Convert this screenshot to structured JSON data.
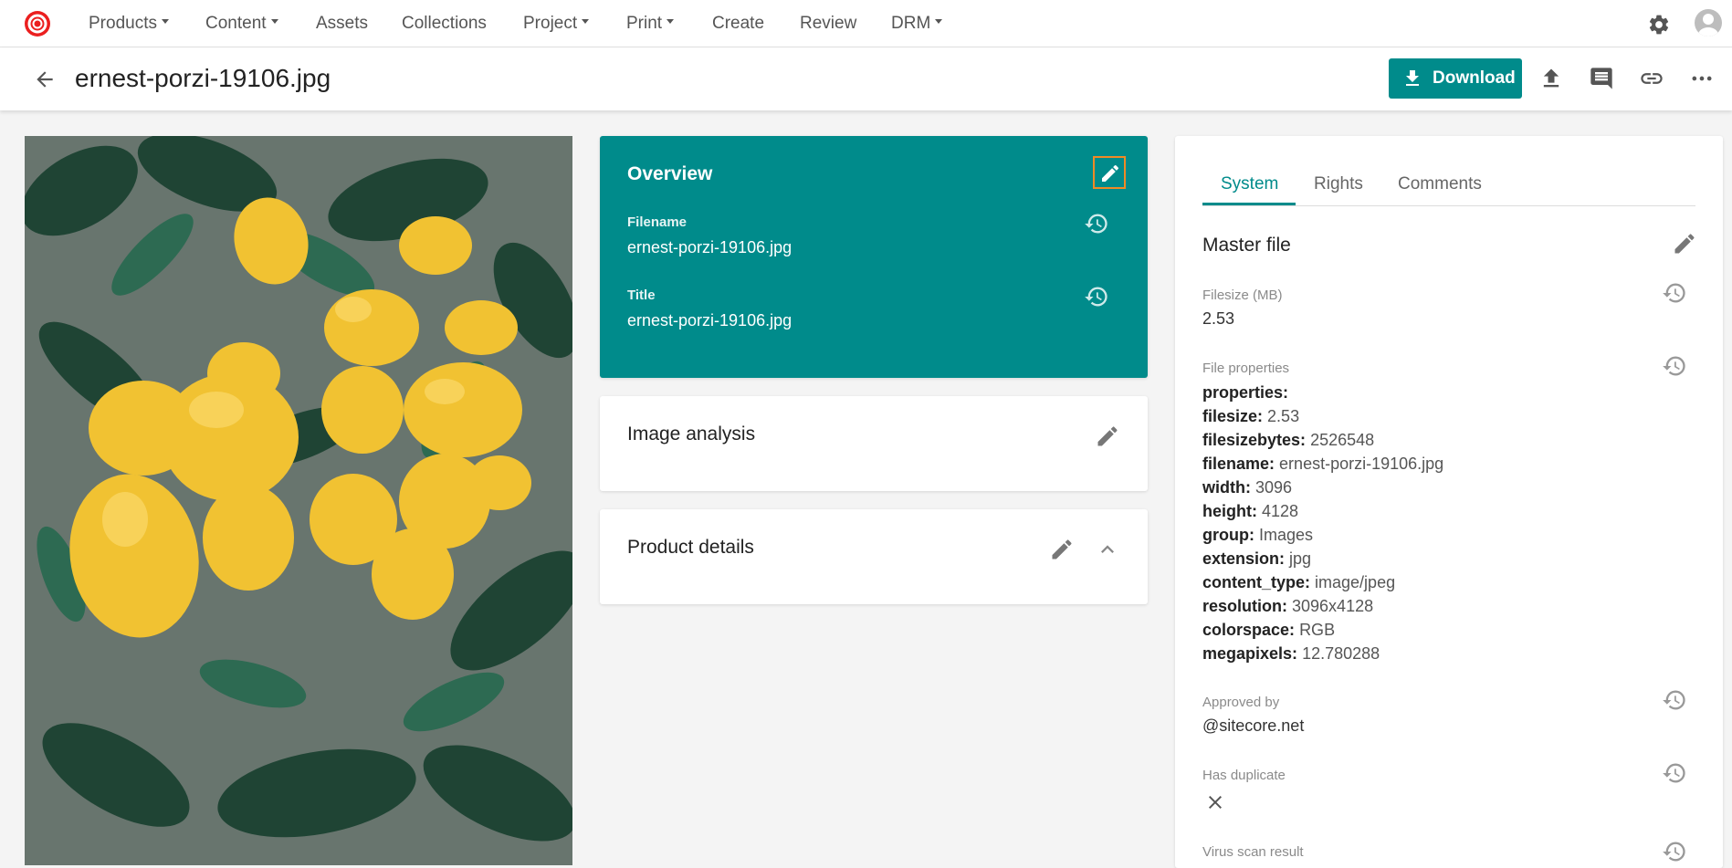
{
  "nav": {
    "items": [
      {
        "label": "Products",
        "dropdown": true
      },
      {
        "label": "Content",
        "dropdown": true
      },
      {
        "label": "Assets",
        "dropdown": false
      },
      {
        "label": "Collections",
        "dropdown": false
      },
      {
        "label": "Project",
        "dropdown": true
      },
      {
        "label": "Print",
        "dropdown": true
      },
      {
        "label": "Create",
        "dropdown": false
      },
      {
        "label": "Review",
        "dropdown": false
      },
      {
        "label": "DRM",
        "dropdown": true
      }
    ],
    "settings_icon": "gear-icon",
    "avatar_icon": "user-avatar-icon"
  },
  "header": {
    "title": "ernest-porzi-19106.jpg",
    "download_label": "Download",
    "icons": [
      "upload-icon",
      "comment-icon",
      "link-icon",
      "more-icon"
    ]
  },
  "colors": {
    "accent": "#008b8b",
    "highlight": "#f08a24"
  },
  "overview": {
    "title": "Overview",
    "filename_label": "Filename",
    "filename_value": "ernest-porzi-19106.jpg",
    "title_label": "Title",
    "title_value": "ernest-porzi-19106.jpg"
  },
  "image_analysis": {
    "title": "Image analysis"
  },
  "product_details": {
    "title": "Product details"
  },
  "right_panel": {
    "tabs": [
      "System",
      "Rights",
      "Comments"
    ],
    "active_tab": "System",
    "section_title": "Master file",
    "filesize_label": "Filesize (MB)",
    "filesize_value": "2.53",
    "file_properties_label": "File properties",
    "properties_header": "properties:",
    "properties": [
      {
        "key": "filesize:",
        "value": "2.53"
      },
      {
        "key": "filesizebytes:",
        "value": "2526548"
      },
      {
        "key": "filename:",
        "value": "ernest-porzi-19106.jpg"
      },
      {
        "key": "width:",
        "value": "3096"
      },
      {
        "key": "height:",
        "value": "4128"
      },
      {
        "key": "group:",
        "value": "Images"
      },
      {
        "key": "extension:",
        "value": "jpg"
      },
      {
        "key": "content_type:",
        "value": "image/jpeg"
      },
      {
        "key": "resolution:",
        "value": "3096x4128"
      },
      {
        "key": "colorspace:",
        "value": "RGB"
      },
      {
        "key": "megapixels:",
        "value": "12.780288"
      }
    ],
    "approved_by_label": "Approved by",
    "approved_by_value": "@sitecore.net",
    "has_duplicate_label": "Has duplicate",
    "has_duplicate_icon": "close-icon",
    "virus_scan_label": "Virus scan result"
  }
}
